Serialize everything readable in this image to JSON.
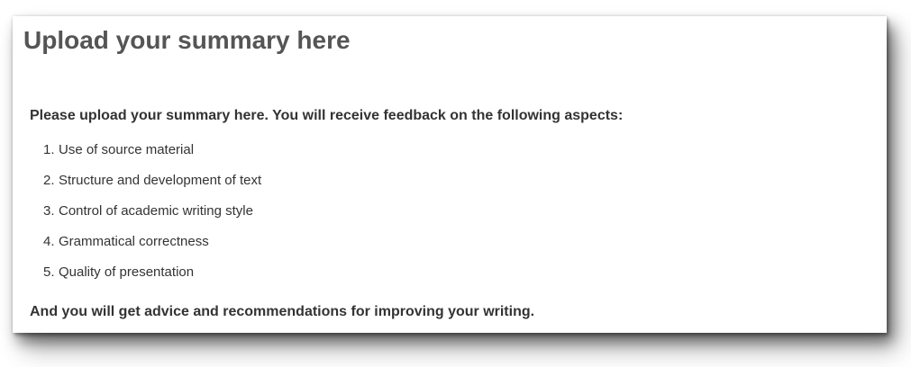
{
  "panel": {
    "title": "Upload your summary here",
    "intro": "Please upload your summary here. You will receive feedback on the following aspects:",
    "aspects": [
      {
        "number": "1.",
        "label": "Use of source material"
      },
      {
        "number": "2.",
        "label": "Structure and development of text"
      },
      {
        "number": "3.",
        "label": "Control of academic writing style"
      },
      {
        "number": "4.",
        "label": "Grammatical correctness"
      },
      {
        "number": "5.",
        "label": "Quality of presentation"
      }
    ],
    "outro": "And you will get advice and recommendations for improving your writing."
  },
  "colors": {
    "title": "#555555",
    "body_text": "#333333",
    "background": "#ffffff"
  }
}
